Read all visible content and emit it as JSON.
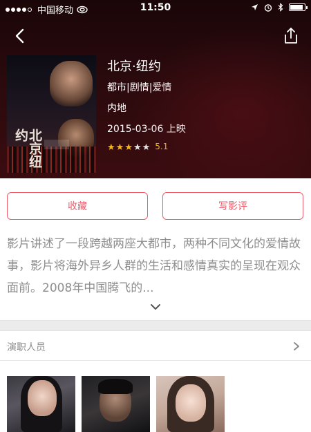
{
  "status_bar": {
    "carrier": "中国移动",
    "time": "11:50",
    "signal_dots_filled": 4,
    "signal_dots_total": 5,
    "battery_level": 0.9
  },
  "nav": {
    "back_icon": "chevron-left-icon",
    "share_icon": "share-icon"
  },
  "movie": {
    "title": "北京·纽约",
    "genres": "都市|剧情|爱情",
    "region": "内地",
    "release": "2015-03-06 上映",
    "stars_filled": 3,
    "stars_total": 5,
    "score": "5.1",
    "poster_text": "北京纽约"
  },
  "actions": {
    "favorite_label": "收藏",
    "review_label": "写影评"
  },
  "synopsis": {
    "text": "影片讲述了一段跨越两座大都市，两种不同文化的爱情故事，影片将海外异乡人群的生活和感情真实的呈现在观众面前。2008年中国腾飞的..."
  },
  "cast": {
    "title": "演职人员",
    "members": 3
  },
  "colors": {
    "accent": "#ee5b6b",
    "star": "#f2b61c",
    "header_bg": "#2a0a0d",
    "muted_text": "#8e8e8e"
  }
}
